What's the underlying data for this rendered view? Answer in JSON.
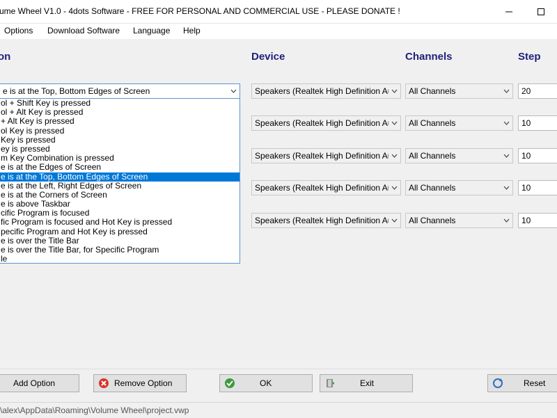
{
  "window": {
    "title": "ume Wheel V1.0 - 4dots Software - FREE FOR PERSONAL AND COMMERCIAL USE - PLEASE DONATE !"
  },
  "menu": [
    {
      "label": "Options",
      "name": "menu-options"
    },
    {
      "label": "Download Software",
      "name": "menu-download-software"
    },
    {
      "label": "Language",
      "name": "menu-language"
    },
    {
      "label": "Help",
      "name": "menu-help"
    }
  ],
  "headers": {
    "action": "on",
    "device": "Device",
    "channels": "Channels",
    "step": "Step"
  },
  "rows": [
    {
      "action": "e is at the Top, Bottom Edges of Screen",
      "device": "Speakers (Realtek High Definition Audio)",
      "channels": "All Channels",
      "step": "20"
    },
    {
      "action": "",
      "device": "Speakers (Realtek High Definition Audio)",
      "channels": "All Channels",
      "step": "10"
    },
    {
      "action": "",
      "device": "Speakers (Realtek High Definition Audio)",
      "channels": "All Channels",
      "step": "10"
    },
    {
      "action": "",
      "device": "Speakers (Realtek High Definition Audio)",
      "channels": "All Channels",
      "step": "10"
    },
    {
      "action": "",
      "device": "Speakers (Realtek High Definition Audio)",
      "channels": "All Channels",
      "step": "10"
    }
  ],
  "dropdown": {
    "items": [
      "ol + Shift Key is pressed",
      "ol + Alt Key is pressed",
      "+ Alt Key is pressed",
      "ol Key is pressed",
      "Key is pressed",
      "ey is pressed",
      "m Key Combination is pressed",
      "e is at the Edges of Screen",
      "e is at the Top, Bottom Edges of Screen",
      "e is at the Left, Right Edges of Screen",
      "e is at the Corners of Screen",
      "e is above Taskbar",
      "cific Program is focused",
      "fic Program is focused and Hot Key is pressed",
      "pecific Program and Hot Key is pressed",
      "e is over the Title Bar",
      "e is over the Title Bar, for Specific Program",
      "le"
    ],
    "selected_index": 8
  },
  "buttons": {
    "add_option": "Add Option",
    "remove_option": "Remove Option",
    "ok": "OK",
    "exit": "Exit",
    "reset": "Reset"
  },
  "status": {
    "path": "s\\alex\\AppData\\Roaming\\Volume Wheel\\project.vwp"
  },
  "colors": {
    "header_text": "#1f1f7a",
    "selection": "#0078d7",
    "focus_border": "#5d92d1"
  }
}
